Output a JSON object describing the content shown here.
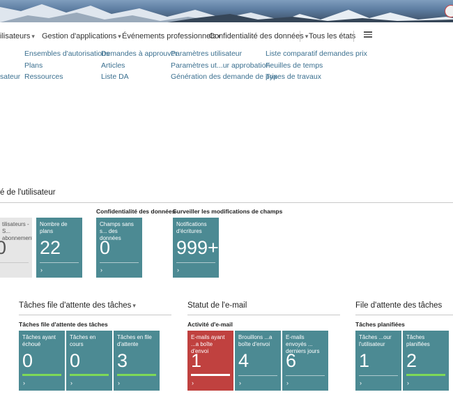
{
  "nav": {
    "items": [
      {
        "label": "ilisateurs",
        "chevron": true
      },
      {
        "label": "Gestion d'applications",
        "chevron": true
      },
      {
        "label": "Événements professionnels",
        "chevron": true
      },
      {
        "label": "Confidentialité des données",
        "chevron": true
      },
      {
        "label": "Tous les états",
        "chevron": false
      }
    ]
  },
  "links": {
    "col0": [
      "sateur"
    ],
    "col1": [
      "Ensembles d'autorisations",
      "Plans",
      "Ressources"
    ],
    "col2": [
      "Demandes à approuver",
      "Articles",
      "Liste DA"
    ],
    "col3": [
      "Paramètres utilisateur",
      "Paramètres ut...ur approbation",
      "Génération des demande de prix"
    ],
    "col4": [
      "Liste comparatif demandes prix",
      "Feuilles de temps",
      "Types de travaux"
    ]
  },
  "section1": {
    "title": "é de l'utilisateur",
    "group_conf": "Confidentialité des données",
    "group_monitor": "Surveiller les modifications de champs",
    "tiles": [
      {
        "label": "tilisateurs - S... abonnement",
        "value": "0"
      },
      {
        "label": "Nombre de plans",
        "value": "22"
      },
      {
        "label": "Champs sans s... des données",
        "value": "0"
      },
      {
        "label": "Notifications d'écritures",
        "value": "999+"
      }
    ]
  },
  "queue": {
    "title": "Tâches file d'attente des tâches",
    "subtitle": "Tâches file d'attente des tâches",
    "tiles": [
      {
        "label": "Tâches ayant échoué",
        "value": "0"
      },
      {
        "label": "Tâches en cours",
        "value": "0"
      },
      {
        "label": "Tâches en file d'attente",
        "value": "3"
      }
    ]
  },
  "email": {
    "title": "Statut de l'e-mail",
    "subtitle": "Activité d'e-mail",
    "tiles": [
      {
        "label": "E-mails ayant ...a boîte d'envoi",
        "value": "1"
      },
      {
        "label": "Brouillons ...a boîte d'envoi",
        "value": "4"
      },
      {
        "label": "E-mails envoyés ... derniers jours",
        "value": "6"
      }
    ]
  },
  "jobs": {
    "title": "File d'attente des tâches",
    "subtitle": "Tâches planifiées",
    "tiles": [
      {
        "label": "Tâches ...our l'utilisateur",
        "value": "1"
      },
      {
        "label": "Tâches planifiées",
        "value": "2"
      }
    ]
  },
  "icons": {
    "chevron": "▾",
    "arrow": "›",
    "menu": "hamburger-icon"
  }
}
